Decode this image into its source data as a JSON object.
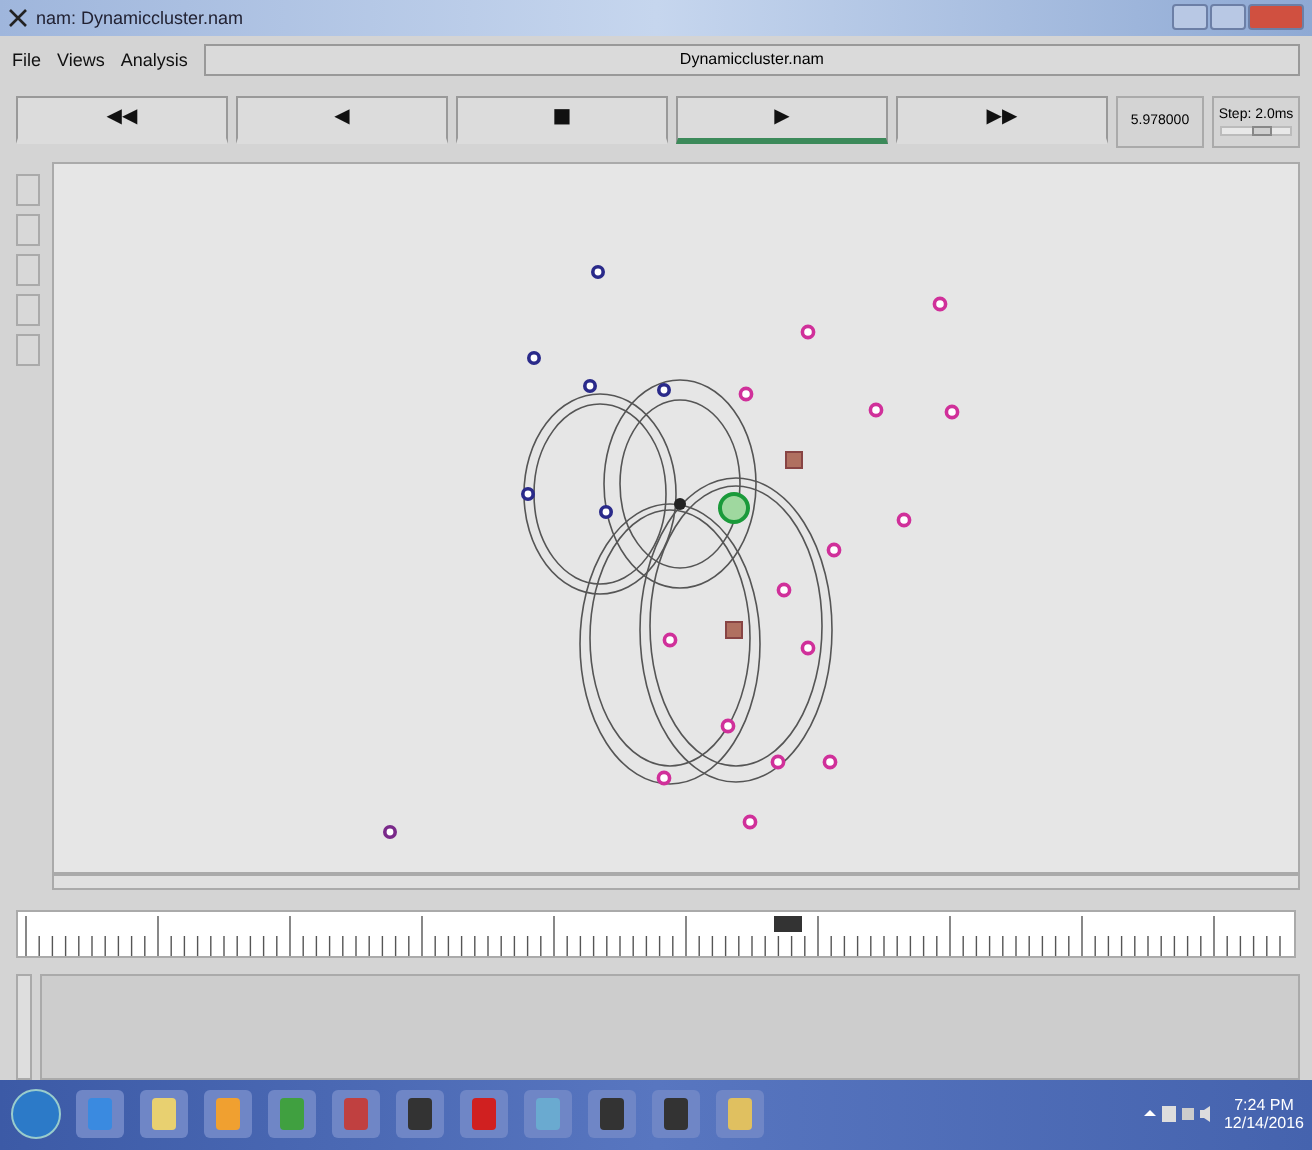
{
  "window": {
    "title": "nam: Dynamiccluster.nam"
  },
  "menu": [
    "File",
    "Views",
    "Analysis"
  ],
  "file_name": "Dynamiccluster.nam",
  "controls": [
    {
      "label": "◀◀",
      "selected": false
    },
    {
      "label": "◀",
      "selected": false
    },
    {
      "label": "■",
      "selected": false
    },
    {
      "label": "▶",
      "selected": true
    },
    {
      "label": "▶▶",
      "selected": false
    }
  ],
  "time": "5.978000",
  "step": {
    "label": "Step: 2.0ms",
    "level": 0.6
  },
  "taskbar": {
    "time": "7:24 PM",
    "date": "12/14/2016"
  }
}
